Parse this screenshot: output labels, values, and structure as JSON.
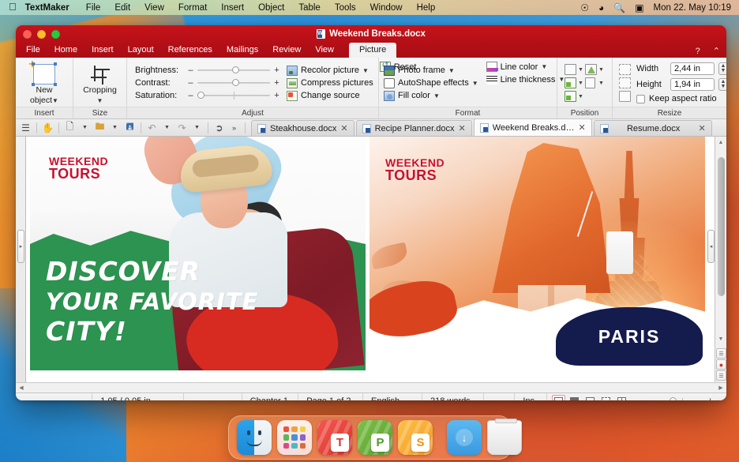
{
  "menubar": {
    "apple_icon": "apple-logo",
    "app_name": "TextMaker",
    "items": [
      "File",
      "Edit",
      "View",
      "Format",
      "Insert",
      "Object",
      "Table",
      "Tools",
      "Window",
      "Help"
    ],
    "status_icons": [
      "control-center-icon",
      "wifi-icon",
      "spotlight-search-icon",
      "siri-icon"
    ],
    "clock": "Mon 22. May  10:19"
  },
  "window": {
    "title": "Weekend Breaks.docx",
    "help_button": "?",
    "collapse_button": "⌃",
    "accent_color": "#b50f17"
  },
  "ribbon": {
    "tabs": [
      "File",
      "Home",
      "Insert",
      "Layout",
      "References",
      "Mailings",
      "Review",
      "View"
    ],
    "context_tab": "Picture",
    "groups": {
      "insert": {
        "label": "Insert",
        "new_object": "New\nobject",
        "new_object_line1": "New",
        "new_object_line2": "object"
      },
      "size": {
        "label": "Size",
        "cropping": "Cropping"
      },
      "adjust": {
        "label": "Adjust",
        "sliders": [
          {
            "label": "Brightness:",
            "value": 50
          },
          {
            "label": "Contrast:",
            "value": 50
          },
          {
            "label": "Saturation:",
            "value": 2
          }
        ],
        "commands": [
          "Recolor picture",
          "Compress pictures",
          "Change source"
        ],
        "reset": "Reset"
      },
      "format": {
        "label": "Format",
        "left_commands": [
          "Photo frame",
          "AutoShape effects",
          "Fill color"
        ],
        "right_commands": [
          "Line color",
          "Line thickness"
        ]
      },
      "position": {
        "label": "Position"
      },
      "resize": {
        "label": "Resize",
        "width_label": "Width",
        "width_value": "2,44 in",
        "height_label": "Height",
        "height_value": "1,94 in",
        "keep_aspect_label": "Keep aspect ratio",
        "keep_aspect_checked": false
      }
    }
  },
  "toolbar": {
    "buttons": [
      "sidebar-icon",
      "hand-icon",
      "new-document-icon",
      "open-folder-icon",
      "save-icon",
      "undo-icon",
      "redo-icon",
      "select-pointer-icon",
      "overflow-icon"
    ]
  },
  "doctabs": [
    {
      "label": "Steakhouse.docx",
      "active": false,
      "close": "✕"
    },
    {
      "label": "Recipe Planner.docx",
      "active": false,
      "close": "✕"
    },
    {
      "label": "Weekend Breaks.docx",
      "active": true,
      "close": "✕"
    },
    {
      "label": "Resume.docx",
      "active": false,
      "close": "✕"
    }
  ],
  "document": {
    "poster_left": {
      "logo_line1": "WEEKEND",
      "logo_line2": "TOURS",
      "headline_line1": "DISCOVER",
      "headline_line2": "YOUR FAVORITE",
      "headline_line3": "CITY!",
      "accent_color": "#2d9350"
    },
    "poster_right": {
      "logo_line1": "WEEKEND",
      "logo_line2": "TOURS",
      "city_label": "PARIS",
      "accent_color": "#141b4d"
    }
  },
  "statusbar": {
    "position": "1,05 / 0,05 in",
    "chapter": "Chapter 1",
    "page": "Page 1 of 2",
    "language": "English",
    "words": "218 words",
    "insert_mode": "Ins",
    "view_buttons": [
      "page-layout-view",
      "normal-view",
      "outline-view",
      "master-view",
      "reading-view"
    ],
    "zoom_minus": "−",
    "zoom_plus": "+",
    "overflow": "»"
  },
  "dock": {
    "items": [
      {
        "name": "Finder",
        "running": true
      },
      {
        "name": "Launchpad",
        "running": false
      },
      {
        "name": "TextMaker",
        "badge": "T",
        "running": true
      },
      {
        "name": "Presentations",
        "badge": "P",
        "running": false
      },
      {
        "name": "PlanMaker",
        "badge": "S",
        "running": false
      },
      {
        "name": "Downloads",
        "running": false
      },
      {
        "name": "Trash",
        "running": false
      }
    ]
  }
}
